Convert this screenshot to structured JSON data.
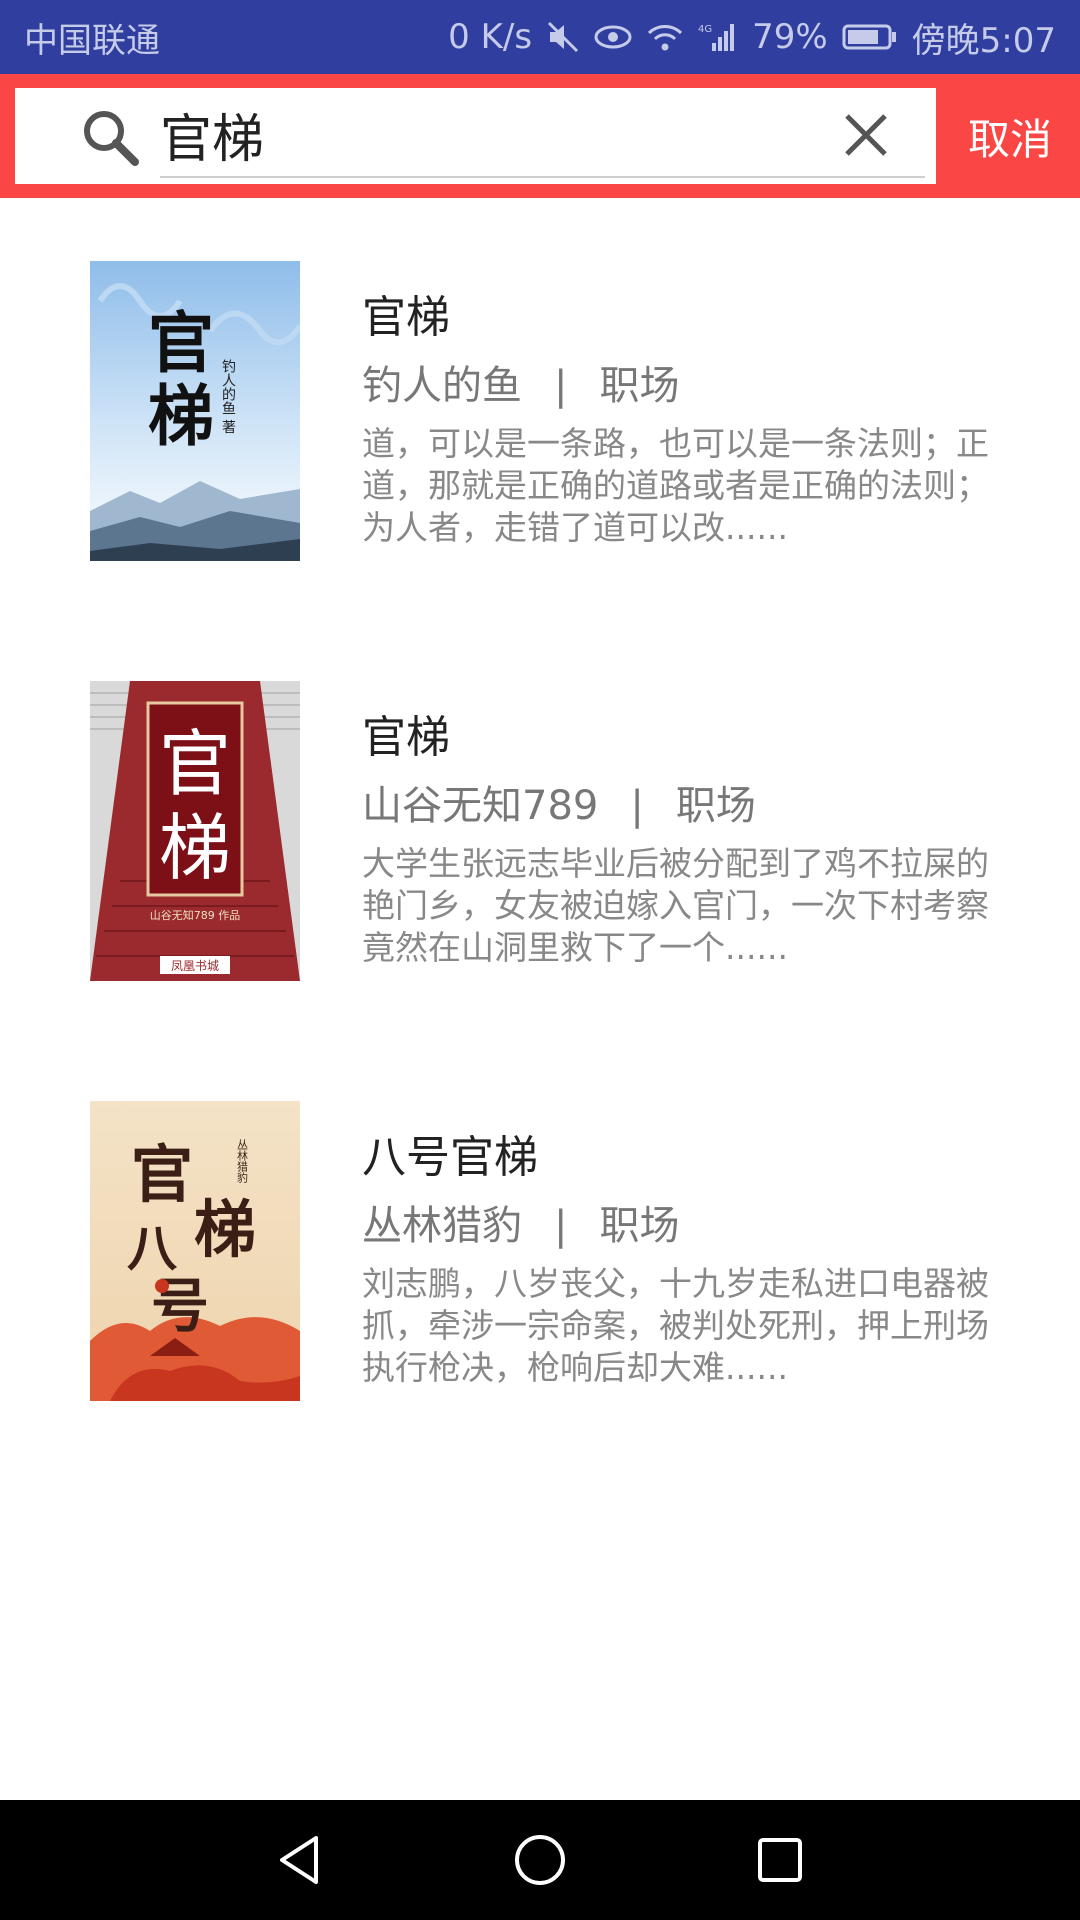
{
  "status_bar": {
    "carrier": "中国联通",
    "speed": "0 K/s",
    "battery": "79%",
    "time": "傍晚5:07"
  },
  "search": {
    "query": "官梯",
    "cancel_label": "取消"
  },
  "results": [
    {
      "title": "官梯",
      "author": "钓人的鱼",
      "separator": "|",
      "category": "职场",
      "description": "道，可以是一条路，也可以是一条法则；正道，那就是正确的道路或者是正确的法则；为人者，走错了道可以改......",
      "cover": {
        "title_text": "官梯",
        "author_text": "钓人的鱼 著",
        "colors": [
          "#a9cdee",
          "#ffffff"
        ]
      }
    },
    {
      "title": "官梯",
      "author": "山谷无知789",
      "separator": "|",
      "category": "职场",
      "description": "大学生张远志毕业后被分配到了鸡不拉屎的艳门乡，女友被迫嫁入官门，一次下村考察竟然在山洞里救下了一个......",
      "cover": {
        "title_text": "官梯",
        "author_text": "山谷无知789 作品",
        "publisher_text": "凤凰书城",
        "colors": [
          "#9a2a2e",
          "#7d1016"
        ]
      }
    },
    {
      "title": "八号官梯",
      "author": "丛林猎豹",
      "separator": "|",
      "category": "职场",
      "description": "刘志鹏，八岁丧父，十九岁走私进口电器被抓，牵涉一宗命案，被判处死刑，押上刑场执行枪决，枪响后却大难......",
      "cover": {
        "title_text": "官梯八号",
        "author_text": "丛林猎豹",
        "colors": [
          "#f3dcbc",
          "#d63d25"
        ]
      }
    }
  ],
  "colors": {
    "status_bar": "#303f9f",
    "header": "#fb4646",
    "title_text": "#222222",
    "meta_text": "#777777",
    "desc_text": "#888888"
  }
}
